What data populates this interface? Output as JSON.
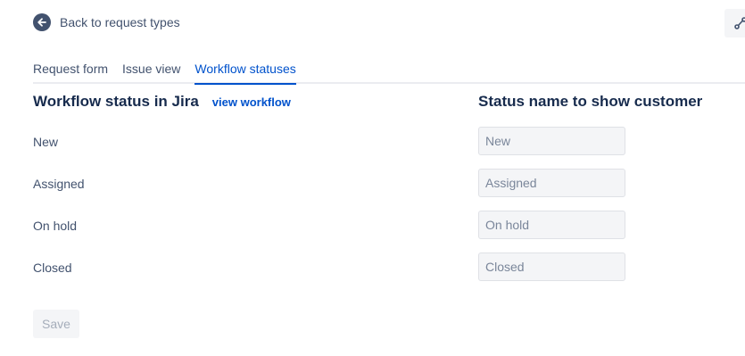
{
  "back_link": {
    "label": "Back to request types",
    "icon": "arrow-left-circle-icon"
  },
  "corner_button": {
    "icon": "workflow-icon"
  },
  "tabs": [
    {
      "label": "Request form",
      "active": false
    },
    {
      "label": "Issue view",
      "active": false
    },
    {
      "label": "Workflow statuses",
      "active": true
    }
  ],
  "main": {
    "left_heading": "Workflow status in Jira",
    "view_workflow_link": "view workflow",
    "right_heading": "Status name to show customer",
    "statuses": [
      {
        "jira_status": "New",
        "customer_name": "New"
      },
      {
        "jira_status": "Assigned",
        "customer_name": "Assigned"
      },
      {
        "jira_status": "On hold",
        "customer_name": "On hold"
      },
      {
        "jira_status": "Closed",
        "customer_name": "Closed"
      }
    ],
    "save_label": "Save"
  },
  "colors": {
    "accent": "#0052cc",
    "text": "#172b4d",
    "subtle_text": "#42526e",
    "input_bg": "#f4f5f7",
    "disabled_text": "#a5adba"
  }
}
